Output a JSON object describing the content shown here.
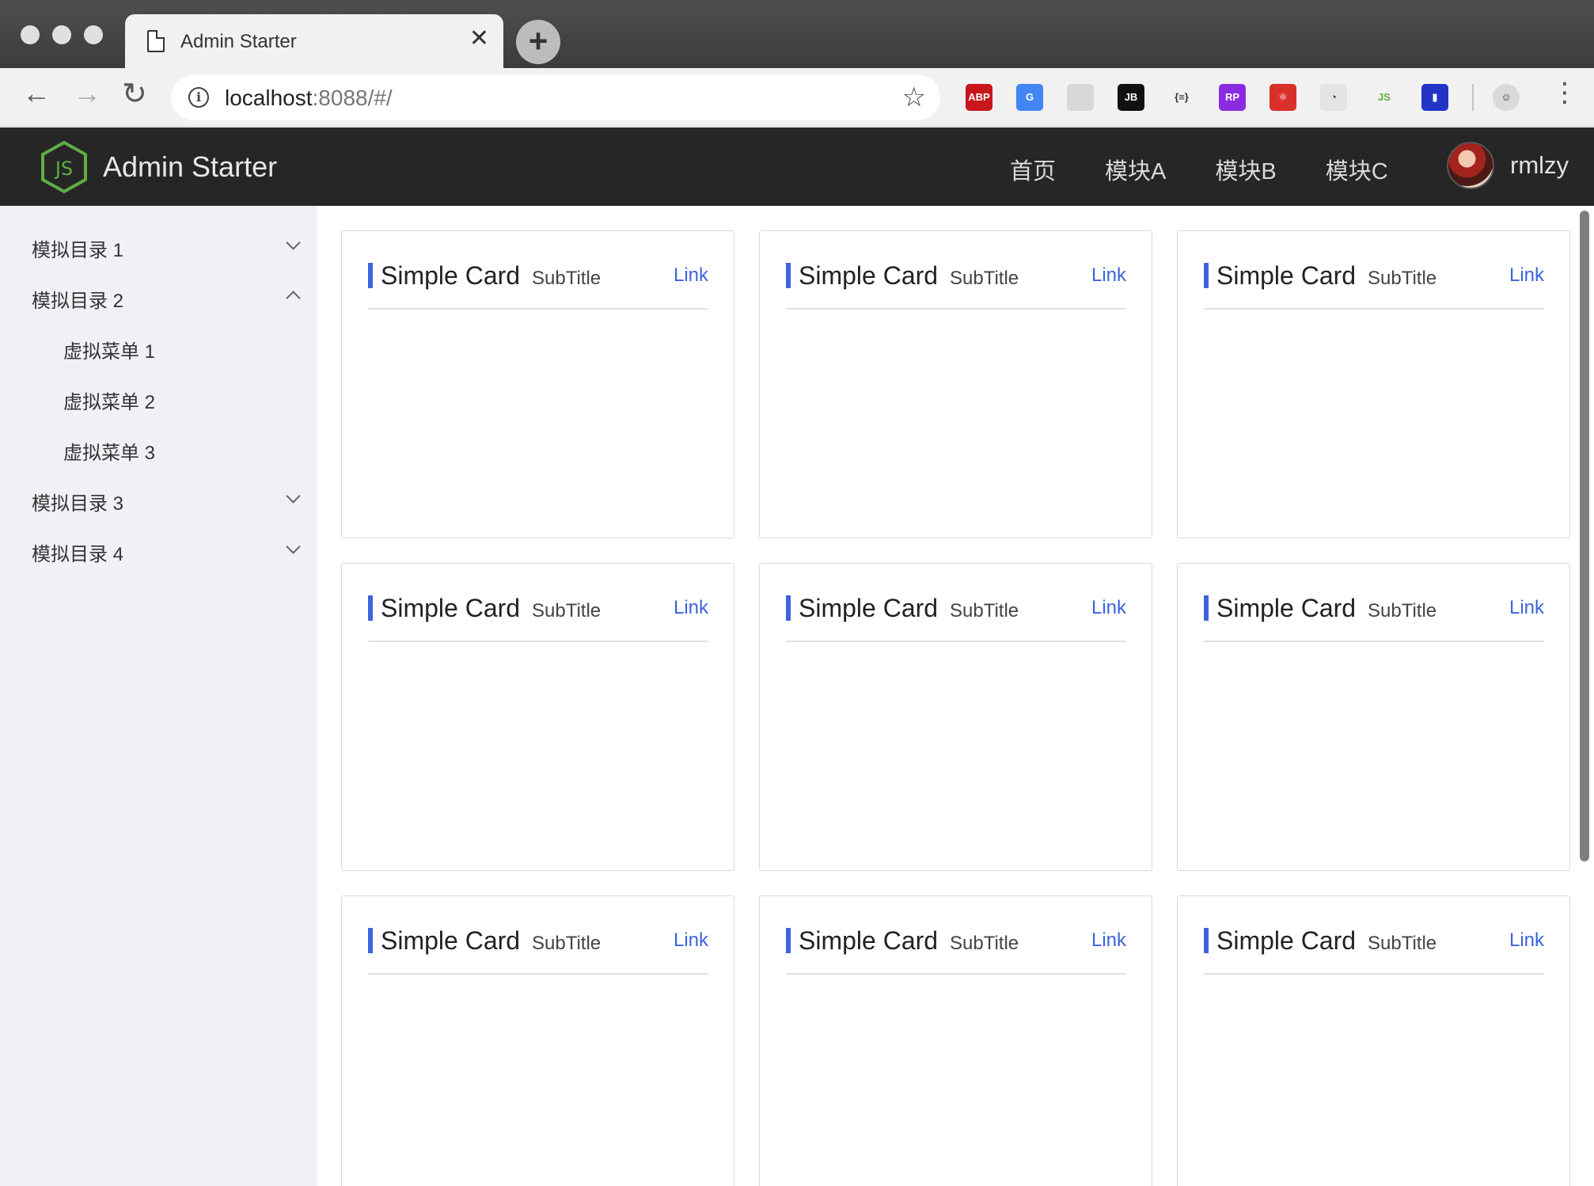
{
  "browser": {
    "tab_title": "Admin Starter",
    "new_tab_label": "+",
    "url_host": "localhost",
    "url_rest": ":8088/#/",
    "extensions": [
      {
        "name": "adblock-plus-icon",
        "label": "ABP",
        "color": "#c8161d"
      },
      {
        "name": "google-translate-icon",
        "label": "G",
        "color": "#4285f4"
      },
      {
        "name": "sitemap-extension-icon",
        "label": "",
        "color": "#d8d8d8"
      },
      {
        "name": "jetbrains-icon",
        "label": "JB",
        "color": "#111111"
      },
      {
        "name": "json-viewer-icon",
        "label": "{≡}",
        "color": "#f1f1f1"
      },
      {
        "name": "axure-rp-icon",
        "label": "RP",
        "color": "#8a2be2"
      },
      {
        "name": "react-devtools-icon",
        "label": "⚛",
        "color": "#d9302a"
      },
      {
        "name": "speed-dashboard-icon",
        "label": "◔",
        "color": "#e4e4e4"
      },
      {
        "name": "nodejs-extension-icon",
        "label": "JS",
        "color": "#f1f1f1"
      },
      {
        "name": "lighthouse-icon",
        "label": "▮",
        "color": "#2234c8"
      }
    ]
  },
  "header": {
    "brand": "Admin Starter",
    "nav": [
      "首页",
      "模块A",
      "模块B",
      "模块C"
    ],
    "username": "rmlzy",
    "colors": {
      "logo_green": "#5fae45",
      "bg": "#262626"
    }
  },
  "sidebar": {
    "items": [
      {
        "label": "模拟目录 1",
        "expanded": false
      },
      {
        "label": "模拟目录 2",
        "expanded": true,
        "children": [
          "虚拟菜单 1",
          "虚拟菜单 2",
          "虚拟菜单 3"
        ]
      },
      {
        "label": "模拟目录 3",
        "expanded": false
      },
      {
        "label": "模拟目录 4",
        "expanded": false
      }
    ]
  },
  "cards": [
    {
      "title": "Simple Card",
      "subtitle": "SubTitle",
      "link": "Link"
    },
    {
      "title": "Simple Card",
      "subtitle": "SubTitle",
      "link": "Link"
    },
    {
      "title": "Simple Card",
      "subtitle": "SubTitle",
      "link": "Link"
    },
    {
      "title": "Simple Card",
      "subtitle": "SubTitle",
      "link": "Link"
    },
    {
      "title": "Simple Card",
      "subtitle": "SubTitle",
      "link": "Link"
    },
    {
      "title": "Simple Card",
      "subtitle": "SubTitle",
      "link": "Link"
    },
    {
      "title": "Simple Card",
      "subtitle": "SubTitle",
      "link": "Link"
    },
    {
      "title": "Simple Card",
      "subtitle": "SubTitle",
      "link": "Link"
    },
    {
      "title": "Simple Card",
      "subtitle": "SubTitle",
      "link": "Link"
    }
  ],
  "accent_color": "#3d63dd"
}
